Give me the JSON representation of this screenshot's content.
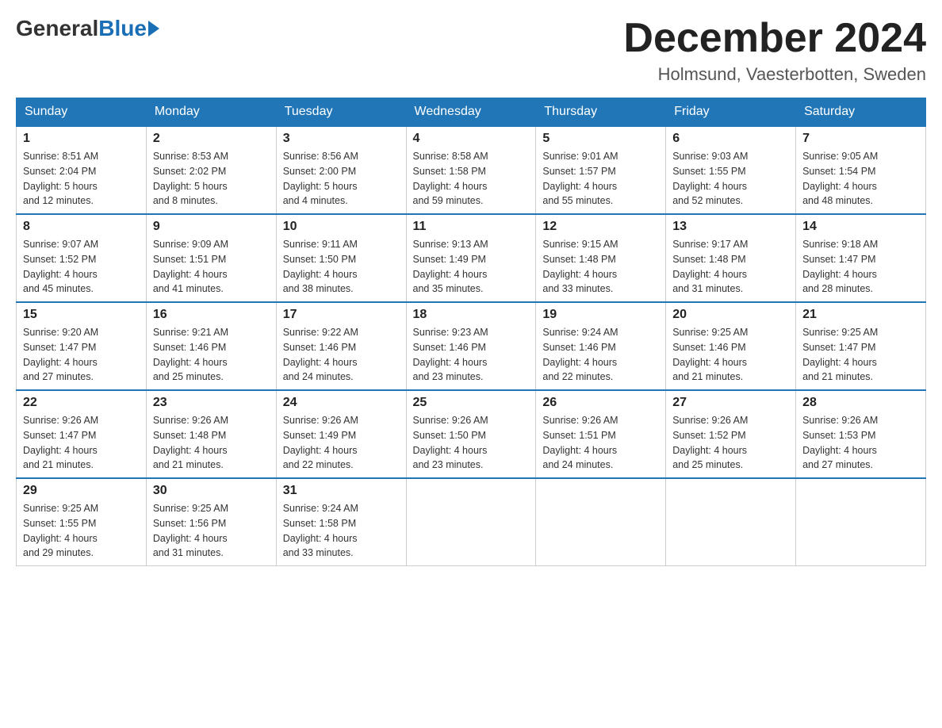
{
  "header": {
    "logo": {
      "general": "General",
      "blue": "Blue"
    },
    "title": "December 2024",
    "location": "Holmsund, Vaesterbotten, Sweden"
  },
  "days_of_week": [
    "Sunday",
    "Monday",
    "Tuesday",
    "Wednesday",
    "Thursday",
    "Friday",
    "Saturday"
  ],
  "weeks": [
    [
      {
        "day": "1",
        "sunrise": "8:51 AM",
        "sunset": "2:04 PM",
        "daylight": "5 hours and 12 minutes."
      },
      {
        "day": "2",
        "sunrise": "8:53 AM",
        "sunset": "2:02 PM",
        "daylight": "5 hours and 8 minutes."
      },
      {
        "day": "3",
        "sunrise": "8:56 AM",
        "sunset": "2:00 PM",
        "daylight": "5 hours and 4 minutes."
      },
      {
        "day": "4",
        "sunrise": "8:58 AM",
        "sunset": "1:58 PM",
        "daylight": "4 hours and 59 minutes."
      },
      {
        "day": "5",
        "sunrise": "9:01 AM",
        "sunset": "1:57 PM",
        "daylight": "4 hours and 55 minutes."
      },
      {
        "day": "6",
        "sunrise": "9:03 AM",
        "sunset": "1:55 PM",
        "daylight": "4 hours and 52 minutes."
      },
      {
        "day": "7",
        "sunrise": "9:05 AM",
        "sunset": "1:54 PM",
        "daylight": "4 hours and 48 minutes."
      }
    ],
    [
      {
        "day": "8",
        "sunrise": "9:07 AM",
        "sunset": "1:52 PM",
        "daylight": "4 hours and 45 minutes."
      },
      {
        "day": "9",
        "sunrise": "9:09 AM",
        "sunset": "1:51 PM",
        "daylight": "4 hours and 41 minutes."
      },
      {
        "day": "10",
        "sunrise": "9:11 AM",
        "sunset": "1:50 PM",
        "daylight": "4 hours and 38 minutes."
      },
      {
        "day": "11",
        "sunrise": "9:13 AM",
        "sunset": "1:49 PM",
        "daylight": "4 hours and 35 minutes."
      },
      {
        "day": "12",
        "sunrise": "9:15 AM",
        "sunset": "1:48 PM",
        "daylight": "4 hours and 33 minutes."
      },
      {
        "day": "13",
        "sunrise": "9:17 AM",
        "sunset": "1:48 PM",
        "daylight": "4 hours and 31 minutes."
      },
      {
        "day": "14",
        "sunrise": "9:18 AM",
        "sunset": "1:47 PM",
        "daylight": "4 hours and 28 minutes."
      }
    ],
    [
      {
        "day": "15",
        "sunrise": "9:20 AM",
        "sunset": "1:47 PM",
        "daylight": "4 hours and 27 minutes."
      },
      {
        "day": "16",
        "sunrise": "9:21 AM",
        "sunset": "1:46 PM",
        "daylight": "4 hours and 25 minutes."
      },
      {
        "day": "17",
        "sunrise": "9:22 AM",
        "sunset": "1:46 PM",
        "daylight": "4 hours and 24 minutes."
      },
      {
        "day": "18",
        "sunrise": "9:23 AM",
        "sunset": "1:46 PM",
        "daylight": "4 hours and 23 minutes."
      },
      {
        "day": "19",
        "sunrise": "9:24 AM",
        "sunset": "1:46 PM",
        "daylight": "4 hours and 22 minutes."
      },
      {
        "day": "20",
        "sunrise": "9:25 AM",
        "sunset": "1:46 PM",
        "daylight": "4 hours and 21 minutes."
      },
      {
        "day": "21",
        "sunrise": "9:25 AM",
        "sunset": "1:47 PM",
        "daylight": "4 hours and 21 minutes."
      }
    ],
    [
      {
        "day": "22",
        "sunrise": "9:26 AM",
        "sunset": "1:47 PM",
        "daylight": "4 hours and 21 minutes."
      },
      {
        "day": "23",
        "sunrise": "9:26 AM",
        "sunset": "1:48 PM",
        "daylight": "4 hours and 21 minutes."
      },
      {
        "day": "24",
        "sunrise": "9:26 AM",
        "sunset": "1:49 PM",
        "daylight": "4 hours and 22 minutes."
      },
      {
        "day": "25",
        "sunrise": "9:26 AM",
        "sunset": "1:50 PM",
        "daylight": "4 hours and 23 minutes."
      },
      {
        "day": "26",
        "sunrise": "9:26 AM",
        "sunset": "1:51 PM",
        "daylight": "4 hours and 24 minutes."
      },
      {
        "day": "27",
        "sunrise": "9:26 AM",
        "sunset": "1:52 PM",
        "daylight": "4 hours and 25 minutes."
      },
      {
        "day": "28",
        "sunrise": "9:26 AM",
        "sunset": "1:53 PM",
        "daylight": "4 hours and 27 minutes."
      }
    ],
    [
      {
        "day": "29",
        "sunrise": "9:25 AM",
        "sunset": "1:55 PM",
        "daylight": "4 hours and 29 minutes."
      },
      {
        "day": "30",
        "sunrise": "9:25 AM",
        "sunset": "1:56 PM",
        "daylight": "4 hours and 31 minutes."
      },
      {
        "day": "31",
        "sunrise": "9:24 AM",
        "sunset": "1:58 PM",
        "daylight": "4 hours and 33 minutes."
      },
      null,
      null,
      null,
      null
    ]
  ],
  "labels": {
    "sunrise": "Sunrise:",
    "sunset": "Sunset:",
    "daylight": "Daylight:"
  }
}
